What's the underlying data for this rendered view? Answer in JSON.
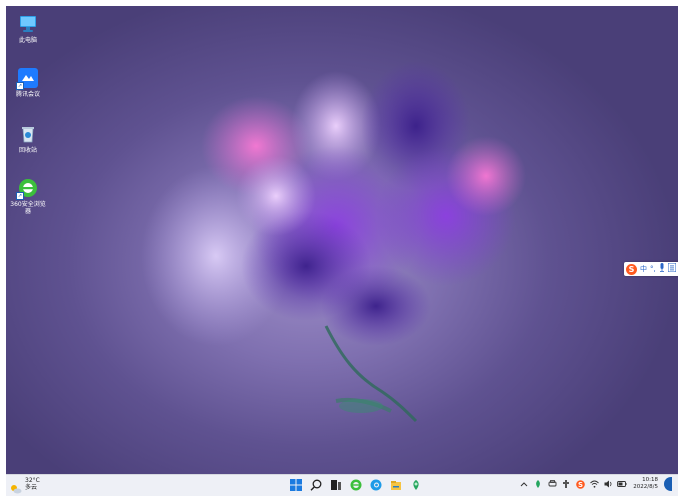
{
  "desktop": {
    "icons": [
      {
        "label": "此电脑",
        "icon": "computer-icon"
      },
      {
        "label": "腾讯会议",
        "icon": "tencent-meeting-icon",
        "shortcut": true
      },
      {
        "label": "回收站",
        "icon": "recycle-bin-icon"
      },
      {
        "label": "360安全浏览器",
        "icon": "360-browser-icon",
        "shortcut": true
      }
    ]
  },
  "ime": {
    "logo": "S",
    "mode": "中",
    "punct": "°,",
    "voice": "mic-icon",
    "menu": "menu-icon"
  },
  "taskbar": {
    "weather": {
      "temp": "32°C",
      "desc": "多云"
    },
    "apps": [
      "windows-start-icon",
      "search-icon",
      "task-view-icon",
      "360-browser-icon",
      "edge-icon",
      "file-explorer-icon",
      "tencent-app-icon"
    ],
    "tray": {
      "clock_time": "10:18",
      "clock_date": "2022/8/5"
    }
  },
  "colors": {
    "taskbar_bg": "#eef0f6",
    "accent": "#1a5fb4",
    "ime_orange": "#ff5a1f"
  }
}
